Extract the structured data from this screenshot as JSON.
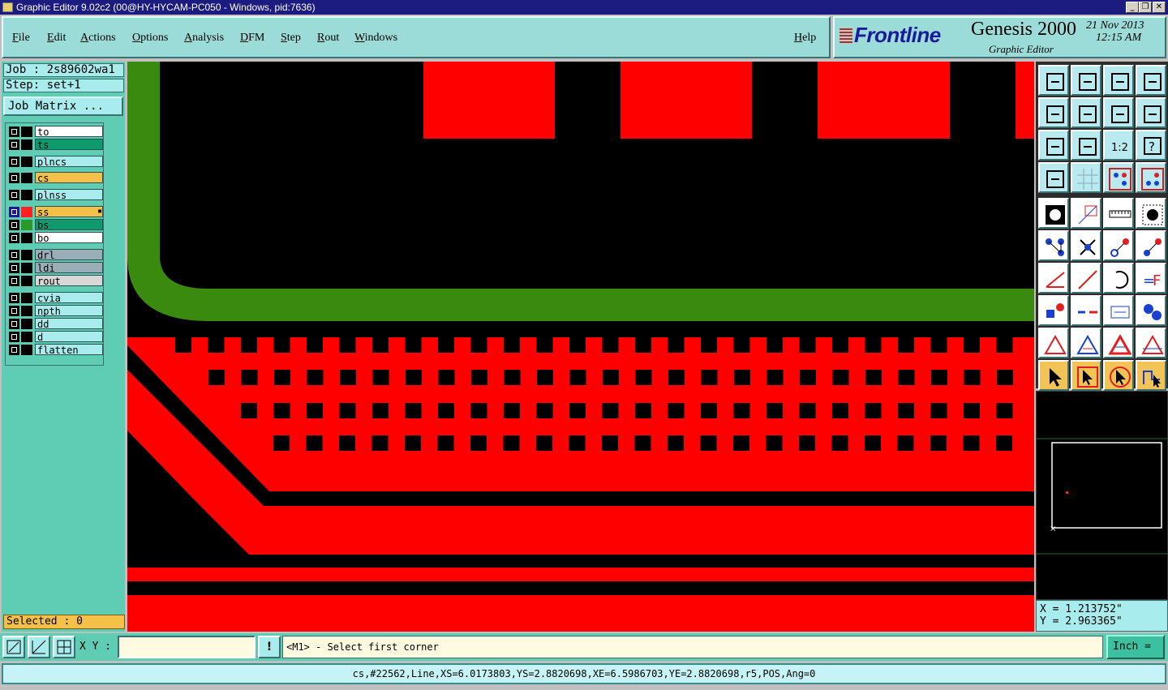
{
  "window": {
    "title": "Graphic Editor 9.02c2 (00@HY-HYCAM-PC050 - Windows, pid:7636)",
    "minimize": "_",
    "restore": "❐",
    "close": "✕"
  },
  "menu": [
    "File",
    "Edit",
    "Actions",
    "Options",
    "Analysis",
    "DFM",
    "Step",
    "Rout",
    "Windows"
  ],
  "help": "Help",
  "brand": {
    "logo": "Frontline",
    "product": "Genesis 2000",
    "subtitle": "Graphic Editor",
    "date": "21 Nov 2013",
    "time": "12:15 AM"
  },
  "job": {
    "job_line": "Job : 2s89602wa1",
    "step_line": "Step: set+1",
    "matrix_button": "Job Matrix ..."
  },
  "layers": [
    {
      "name": "to",
      "color": "#ffffff",
      "active": false
    },
    {
      "name": "ts",
      "color": "#0e9a6c",
      "active": false
    },
    {
      "name": "plncs",
      "color": "#a8ecee",
      "active": false
    },
    {
      "name": "cs",
      "color": "#f4c048",
      "active": false
    },
    {
      "name": "plnss",
      "color": "#a8ecee",
      "active": false
    },
    {
      "name": "ss",
      "color": "#f4c048",
      "active": true,
      "indicator": "#ff2020"
    },
    {
      "name": "bs",
      "color": "#0e9a6c",
      "active": false,
      "indicator": "#2a9a2a"
    },
    {
      "name": "bo",
      "color": "#ffffff",
      "active": false
    },
    {
      "name": "drl",
      "color": "#9aaeb8",
      "active": false
    },
    {
      "name": "ldi",
      "color": "#9aaeb8",
      "active": false
    },
    {
      "name": "rout",
      "color": "#d8d8d8",
      "active": false
    },
    {
      "name": "cvia",
      "color": "#a8ecee",
      "active": false
    },
    {
      "name": "npth",
      "color": "#a8ecee",
      "active": false
    },
    {
      "name": "dd",
      "color": "#a8ecee",
      "active": false
    },
    {
      "name": "d",
      "color": "#a8ecee",
      "active": false
    },
    {
      "name": "flatten",
      "color": "#a8ecee",
      "active": false
    }
  ],
  "selected": "Selected : 0",
  "coords": {
    "x": "X = 1.213752\"",
    "y": "Y = 2.963365\""
  },
  "bottom": {
    "xy_label": "X Y :",
    "xy_value": "",
    "exclaim": "!",
    "prompt": "<M1> - Select first corner",
    "units": "Inch ="
  },
  "status_line": "cs,#22562,Line,XS=6.0173803,YS=2.8820698,XE=6.5986703,YE=2.8820698,r5,POS,Ang=0",
  "colors": {
    "copper": "#ff0000",
    "mask": "#3a8a10",
    "background": "#000000",
    "panel": "#5fcdb3",
    "field": "#a8ecee",
    "highlight": "#f4c048"
  },
  "tools": [
    "copy-up-icon",
    "copy-down-icon",
    "home-icon",
    "split-view-icon",
    "move-left-icon",
    "move-right-icon",
    "mirror-icon",
    "route-s-icon",
    "fit-icon",
    "zoom-center-icon",
    "scale-1-2-icon",
    "query-icon",
    "tool-config-icon",
    "grid-icon",
    "snap-red-icon",
    "snap-blue-icon",
    "pad-circle-icon",
    "select-rect-icon",
    "measure-ruler-icon",
    "dot-icon",
    "connect-nodes-icon",
    "delete-node-icon",
    "node-red-icon",
    "node-blue-icon",
    "angle-icon",
    "line-icon",
    "arc-icon",
    "text-f-icon",
    "point-move-icon",
    "split-line-icon",
    "center-icon",
    "circles-icon",
    "triangle-icon",
    "triangle-2-icon",
    "triangle-3-icon",
    "triangle-4-icon",
    "pointer-icon",
    "pointer-box-icon",
    "pointer-select-icon",
    "pointer-path-icon"
  ],
  "tool_labels": {
    "scale": "1:2",
    "query": "?"
  }
}
